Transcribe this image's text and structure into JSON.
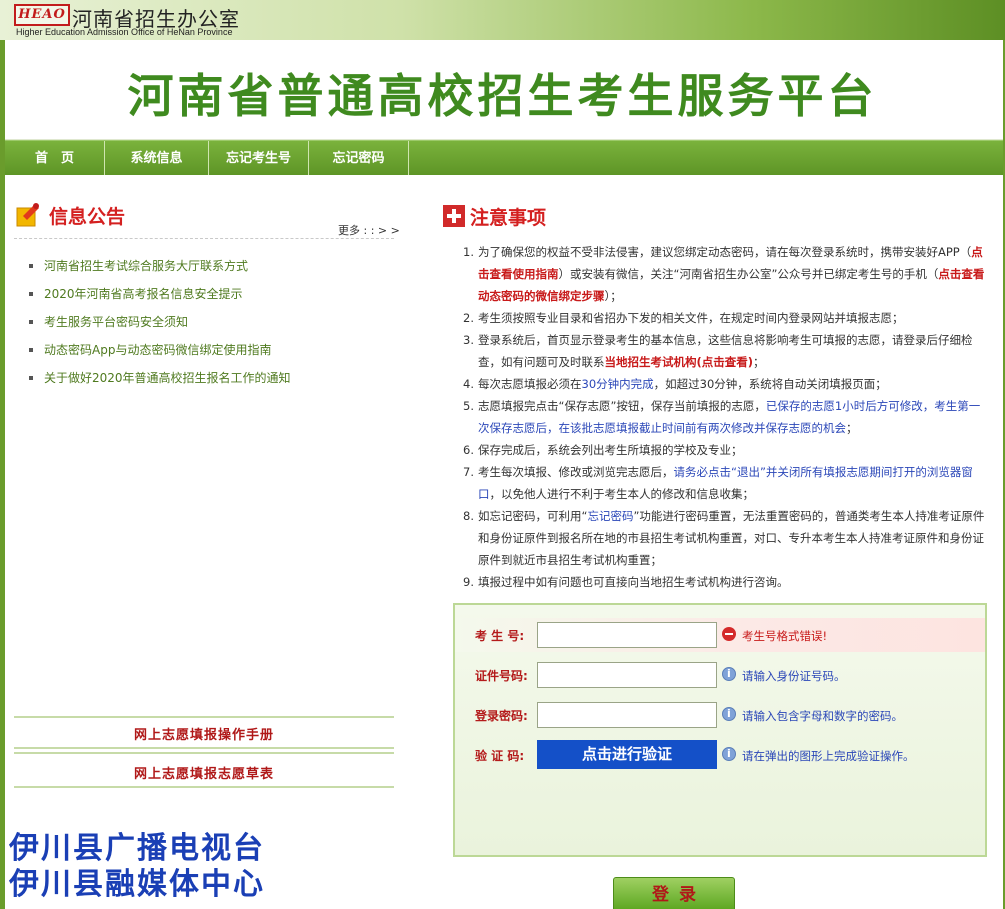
{
  "header": {
    "logo_text": "HEAO",
    "office_title": "河南省招生办公室",
    "office_en": "Higher Education Admission Office of HeNan Province",
    "banner_title": "河南省普通高校招生考生服务平台"
  },
  "nav": {
    "items": [
      {
        "label": "首　页"
      },
      {
        "label": "系统信息"
      },
      {
        "label": "忘记考生号"
      },
      {
        "label": "忘记密码"
      }
    ]
  },
  "notices": {
    "title": "信息公告",
    "more_label": "更多 : : > >",
    "items": [
      {
        "label": "河南省招生考试综合服务大厅联系方式"
      },
      {
        "label": "2020年河南省高考报名信息安全提示"
      },
      {
        "label": "考生服务平台密码安全须知"
      },
      {
        "label": "动态密码App与动态密码微信绑定使用指南"
      },
      {
        "label": "关于做好2020年普通高校招生报名工作的通知"
      }
    ],
    "manual_links": [
      {
        "label": "网上志愿填报操作手册"
      },
      {
        "label": "网上志愿填报志愿草表"
      }
    ]
  },
  "watermark": {
    "line1": "伊川县广播电视台",
    "line2": "伊川县融媒体中心"
  },
  "attention": {
    "title": "注意事项",
    "rules": [
      {
        "num": "1.",
        "t1": "为了确保您的权益不受非法侵害，建议您绑定动态密码，请在每次登录系统时，携带安装好APP（",
        "r1": "点击查看使用指南",
        "t2": "）或安装有微信，关注“河南省招生办公室”公众号并已绑定考生号的手机（",
        "r2": "点击查看动态密码的微信绑定步骤",
        "t3": "）；"
      },
      {
        "num": "2.",
        "t1": "考生须按照专业目录和省招办下发的相关文件，在规定时间内登录网站并填报志愿；"
      },
      {
        "num": "3.",
        "t1": "登录系统后，首页显示登录考生的基本信息，这些信息将影响考生可填报的志愿，请登录后仔细检查，如有问题可及时联系",
        "r1": "当地招生考试机构(点击查看)",
        "t2": "；"
      },
      {
        "num": "4.",
        "t1": "每次志愿填报必须在",
        "b1": "30分钟内完成",
        "t2": "，如超过30分钟，系统将自动关闭填报页面；"
      },
      {
        "num": "5.",
        "t1": "志愿填报完点击“保存志愿”按钮，保存当前填报的志愿，",
        "b1": "已保存的志愿1小时后方可修改，考生第一次保存志愿后，在该批志愿填报截止时间前有两次修改并保存志愿的机会",
        "t2": "；"
      },
      {
        "num": "6.",
        "t1": "保存完成后，系统会列出考生所填报的学校及专业；"
      },
      {
        "num": "7.",
        "t1": "考生每次填报、修改或浏览完志愿后，",
        "b1": "请务必点击“退出”并关闭所有填报志愿期间打开的浏览器窗口",
        "t2": "，以免他人进行不利于考生本人的修改和信息收集；"
      },
      {
        "num": "8.",
        "t1": "如忘记密码，可利用“",
        "r1": "忘记密码",
        "t2": "”功能进行密码重置，无法重置密码的，普通类考生本人持准考证原件和身份证原件到报名所在地的市县招生考试机构重置，对口、专升本考生本人持准考证原件和身份证原件到就近市县招生考试机构重置；"
      },
      {
        "num": "9.",
        "t1": "填报过程中如有问题也可直接向当地招生考试机构进行咨询。"
      }
    ]
  },
  "login": {
    "exam_label": "考 生 号:",
    "exam_value": "",
    "exam_hint": "考生号格式错误!",
    "id_label": "证件号码:",
    "id_value": "",
    "id_hint": "请输入身份证号码。",
    "pwd_label": "登录密码:",
    "pwd_value": "",
    "pwd_hint": "请输入包含字母和数字的密码。",
    "captcha_label": "验 证 码:",
    "captcha_button": "点击进行验证",
    "captcha_hint": "请在弹出的图形上完成验证操作。",
    "submit_label": "登录"
  },
  "colors": {
    "brand_green": "#5e9526",
    "title_green": "#3f8a1f",
    "accent_red": "#d42020",
    "link_blue": "#2b47b8",
    "verify_blue": "#1450c8"
  }
}
